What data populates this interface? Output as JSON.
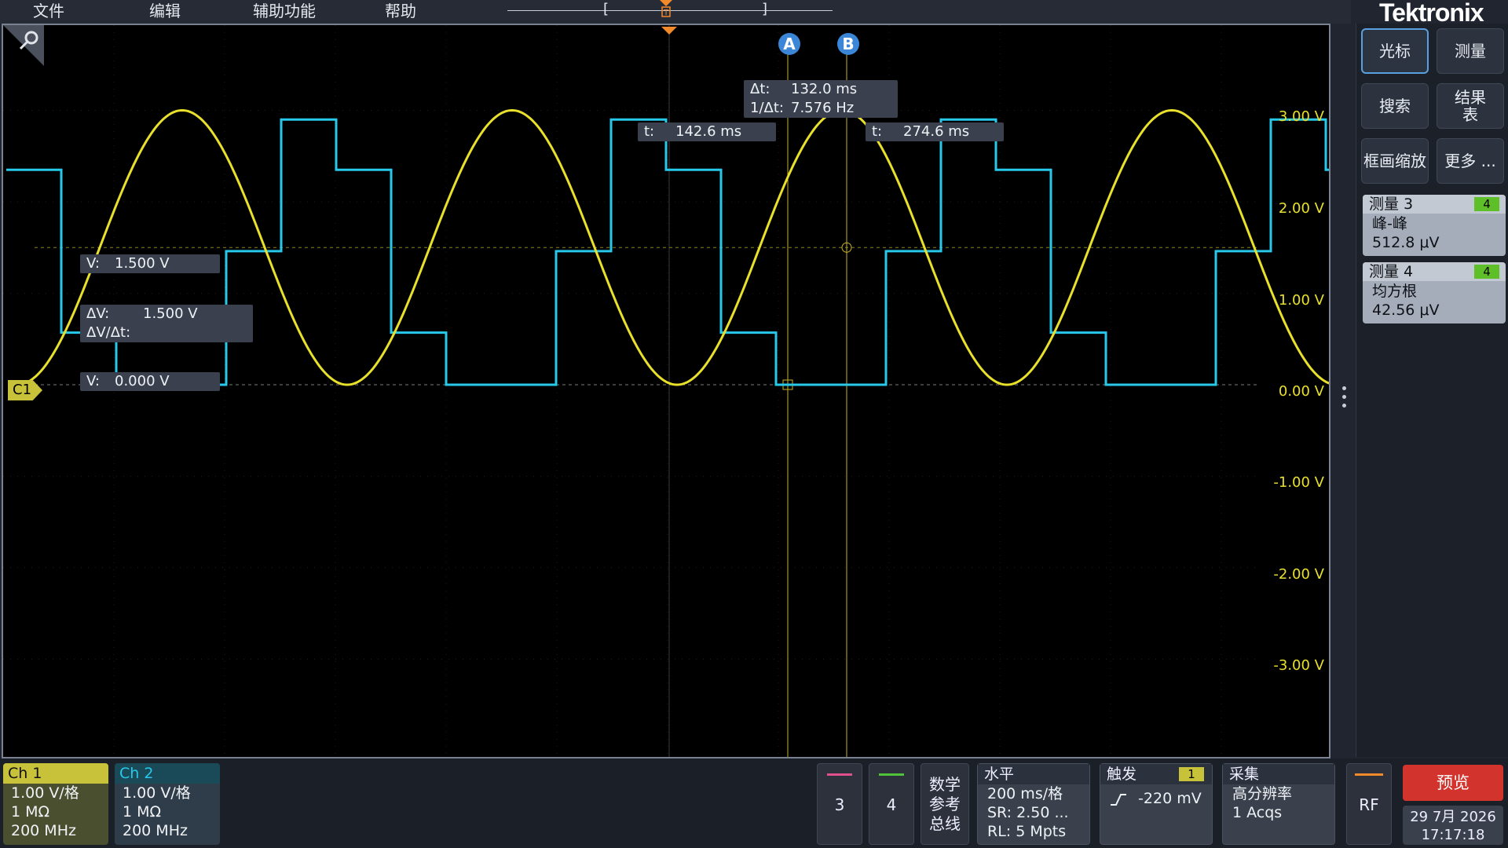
{
  "menu": [
    "文件",
    "编辑",
    "辅助功能",
    "帮助"
  ],
  "brand": "Tektronix",
  "timeline": {
    "left_bracket": "[",
    "right_bracket": "]",
    "trigger_marker": "T"
  },
  "display": {
    "cursor_a": "A",
    "cursor_b": "B",
    "ch1_marker": "C1",
    "delta_t_label": "Δt:",
    "delta_t_value": "132.0 ms",
    "inv_delta_t_label": "1/Δt:",
    "inv_delta_t_value": "7.576 Hz",
    "cursor_a_t_label": "t:",
    "cursor_a_t_value": "142.6 ms",
    "cursor_b_t_label": "t:",
    "cursor_b_t_value": "274.6 ms",
    "cursor_b_v_label": "V:",
    "cursor_b_v_value": "1.500 V",
    "delta_v_label": "ΔV:",
    "delta_v_value": "1.500 V",
    "dv_dt_label": "ΔV/Δt:",
    "cursor_a_v_label": "V:",
    "cursor_a_v_value": "0.000 V",
    "vscale": [
      "3.00 V",
      "2.00 V",
      "1.00 V",
      "0.00 V",
      "-1.00 V",
      "-2.00 V",
      "-3.00 V"
    ],
    "colors": {
      "ch1": "#e8e02a",
      "ch2": "#27c8ea",
      "cursor": "#c8b02a",
      "trigger": "#f08a2a"
    }
  },
  "waveforms": {
    "ch1": {
      "type": "sine",
      "amplitude_v": 1.5,
      "offset_v": 1.5,
      "frequency_hz": 2.35
    },
    "ch2": {
      "type": "stepped-sine (DAC)",
      "levels_v": [
        0.0,
        0.57,
        1.46,
        2.35,
        2.9
      ]
    }
  },
  "right_panel": {
    "cursors_button": "光标",
    "measure_button": "测量",
    "search_button": "搜索",
    "results_button": "结果表",
    "zoom_button": "框画缩放",
    "more_button": "更多 ...",
    "meas3": {
      "title": "测量 3",
      "badge": "4",
      "type": "峰-峰",
      "value": "512.8 μV"
    },
    "meas4": {
      "title": "测量 4",
      "badge": "4",
      "type": "均方根",
      "value": "42.56 μV"
    }
  },
  "bottom": {
    "ch1": {
      "title": "Ch 1",
      "scale": "1.00 V/格",
      "impedance": "1 MΩ",
      "bandwidth": "200 MHz"
    },
    "ch2": {
      "title": "Ch 2",
      "scale": "1.00 V/格",
      "impedance": "1 MΩ",
      "bandwidth": "200 MHz"
    },
    "ch3_label": "3",
    "ch4_label": "4",
    "math_ref_bus": [
      "数学",
      "参考",
      "总线"
    ],
    "horizontal": {
      "title": "水平",
      "scale": "200 ms/格",
      "sr": "SR: 2.50 ...",
      "rl": "RL: 5 Mpts"
    },
    "trigger": {
      "title": "触发",
      "source": "1",
      "level": "-220 mV"
    },
    "acquire": {
      "title": "采集",
      "mode": "高分辨率",
      "count": "1 Acqs"
    },
    "rf_label": "RF",
    "preview_label": "预览",
    "date": "29 7月 2026",
    "time": "17:17:18"
  }
}
